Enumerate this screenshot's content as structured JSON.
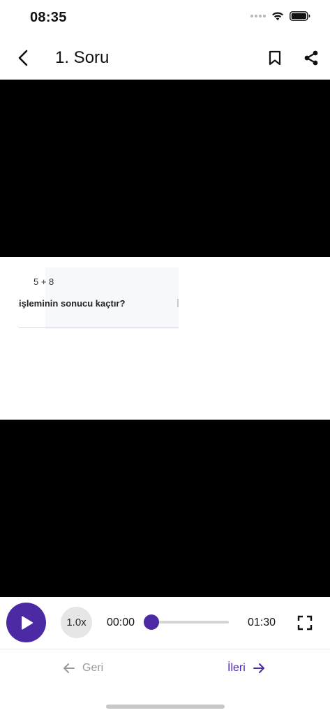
{
  "status_bar": {
    "time": "08:35",
    "icons": [
      "signal-icon",
      "wifi-icon",
      "battery-icon"
    ]
  },
  "header": {
    "title": "1. Soru",
    "icons": [
      "back-arrow-icon",
      "bookmark-icon",
      "share-icon"
    ]
  },
  "video": {
    "question_expression": "5 + 8",
    "question_text": "işleminin sonucu kaçtır?"
  },
  "player": {
    "speed_label": "1.0x",
    "current_time": "00:00",
    "total_time": "01:30",
    "progress_fraction": 0.0,
    "icons": [
      "play-icon",
      "fullscreen-icon"
    ]
  },
  "navigation": {
    "prev_label": "Geri",
    "next_label": "İleri",
    "icons": [
      "arrow-left-icon",
      "arrow-right-icon"
    ]
  },
  "colors": {
    "accent": "#4b2aa3",
    "video_background": "#000000",
    "inactive_text": "#9a9a9a"
  }
}
